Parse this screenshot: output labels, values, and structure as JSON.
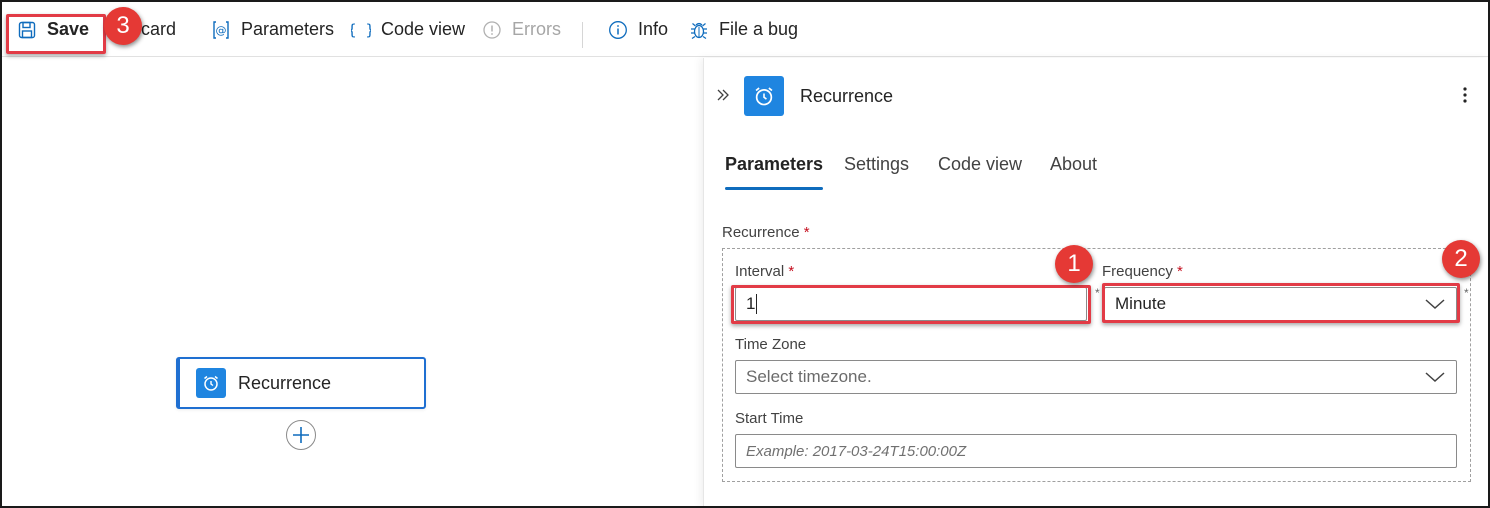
{
  "toolbar": {
    "save": "Save",
    "discard": "Discard",
    "parameters": "Parameters",
    "code_view": "Code view",
    "errors": "Errors",
    "info": "Info",
    "file_bug": "File a bug"
  },
  "canvas": {
    "node_title": "Recurrence"
  },
  "panel": {
    "title": "Recurrence",
    "tabs": [
      "Parameters",
      "Settings",
      "Code view",
      "About"
    ],
    "active_tab": "Parameters",
    "recurrence_label": "Recurrence",
    "interval_label": "Interval",
    "interval_value": "1",
    "frequency_label": "Frequency",
    "frequency_value": "Minute",
    "timezone_label": "Time Zone",
    "timezone_placeholder": "Select timezone.",
    "starttime_label": "Start Time",
    "starttime_placeholder": "Example: 2017-03-24T15:00:00Z",
    "required_marker": "*"
  },
  "annotations": {
    "badge1": "1",
    "badge2": "2",
    "badge3": "3"
  },
  "colors": {
    "accent": "#0f6cbd",
    "node_blue": "#1f85e0",
    "annotation_red": "#e23b46"
  },
  "icons": [
    "save-icon",
    "discard-icon",
    "parameters-icon",
    "braces-icon",
    "error-icon",
    "info-icon",
    "bug-icon",
    "alarm-clock-icon",
    "double-chevron-icon",
    "more-vertical-icon",
    "chevron-down-icon",
    "plus-icon"
  ]
}
